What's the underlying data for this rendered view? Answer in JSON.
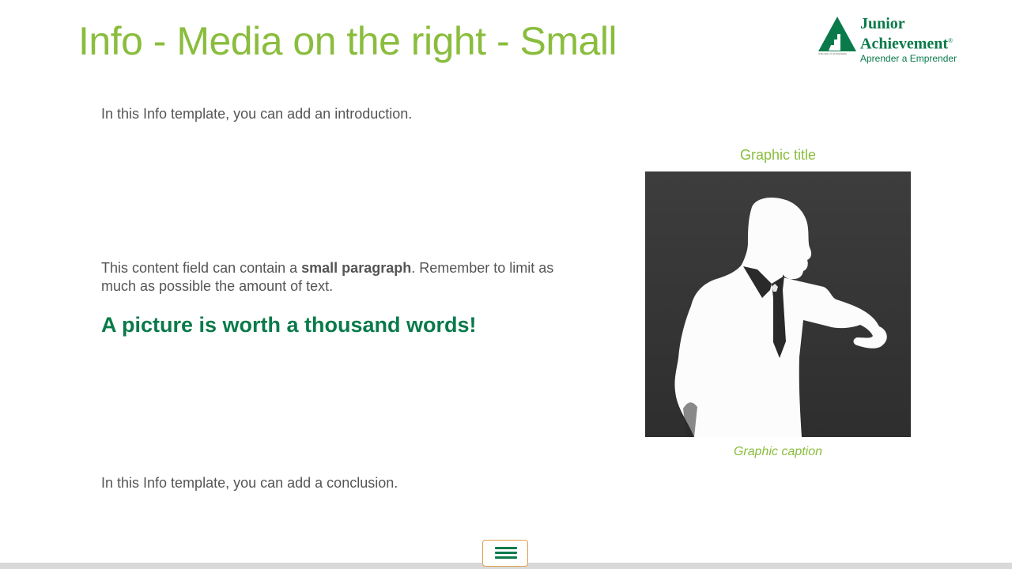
{
  "title": "Info - Media on the right - Small",
  "logo": {
    "line1": "Junior",
    "line2": "Achievement",
    "registered": "®",
    "tagline": "Aprender a Emprender",
    "small_text": "A Member of JA Worldwide"
  },
  "content": {
    "intro": "In this Info template, you can add an introduction.",
    "paragraph_before": "This content field can contain a ",
    "paragraph_bold": "small paragraph",
    "paragraph_after": ". Remember to limit as much as possible the amount of text.",
    "highlight": "A picture is worth a thousand words!",
    "conclusion": "In this Info template, you can add a conclusion."
  },
  "graphic": {
    "title": "Graphic title",
    "caption": "Graphic caption",
    "image_subject": "silhouette of a businessman checking his wristwatch"
  },
  "nav": {
    "menu_icon": "hamburger-menu-icon"
  },
  "colors": {
    "title_green": "#8abd3d",
    "brand_green": "#0a7a4a",
    "text_gray": "#555555",
    "accent_orange": "#e0a048",
    "image_dark": "#3a3a3a"
  }
}
